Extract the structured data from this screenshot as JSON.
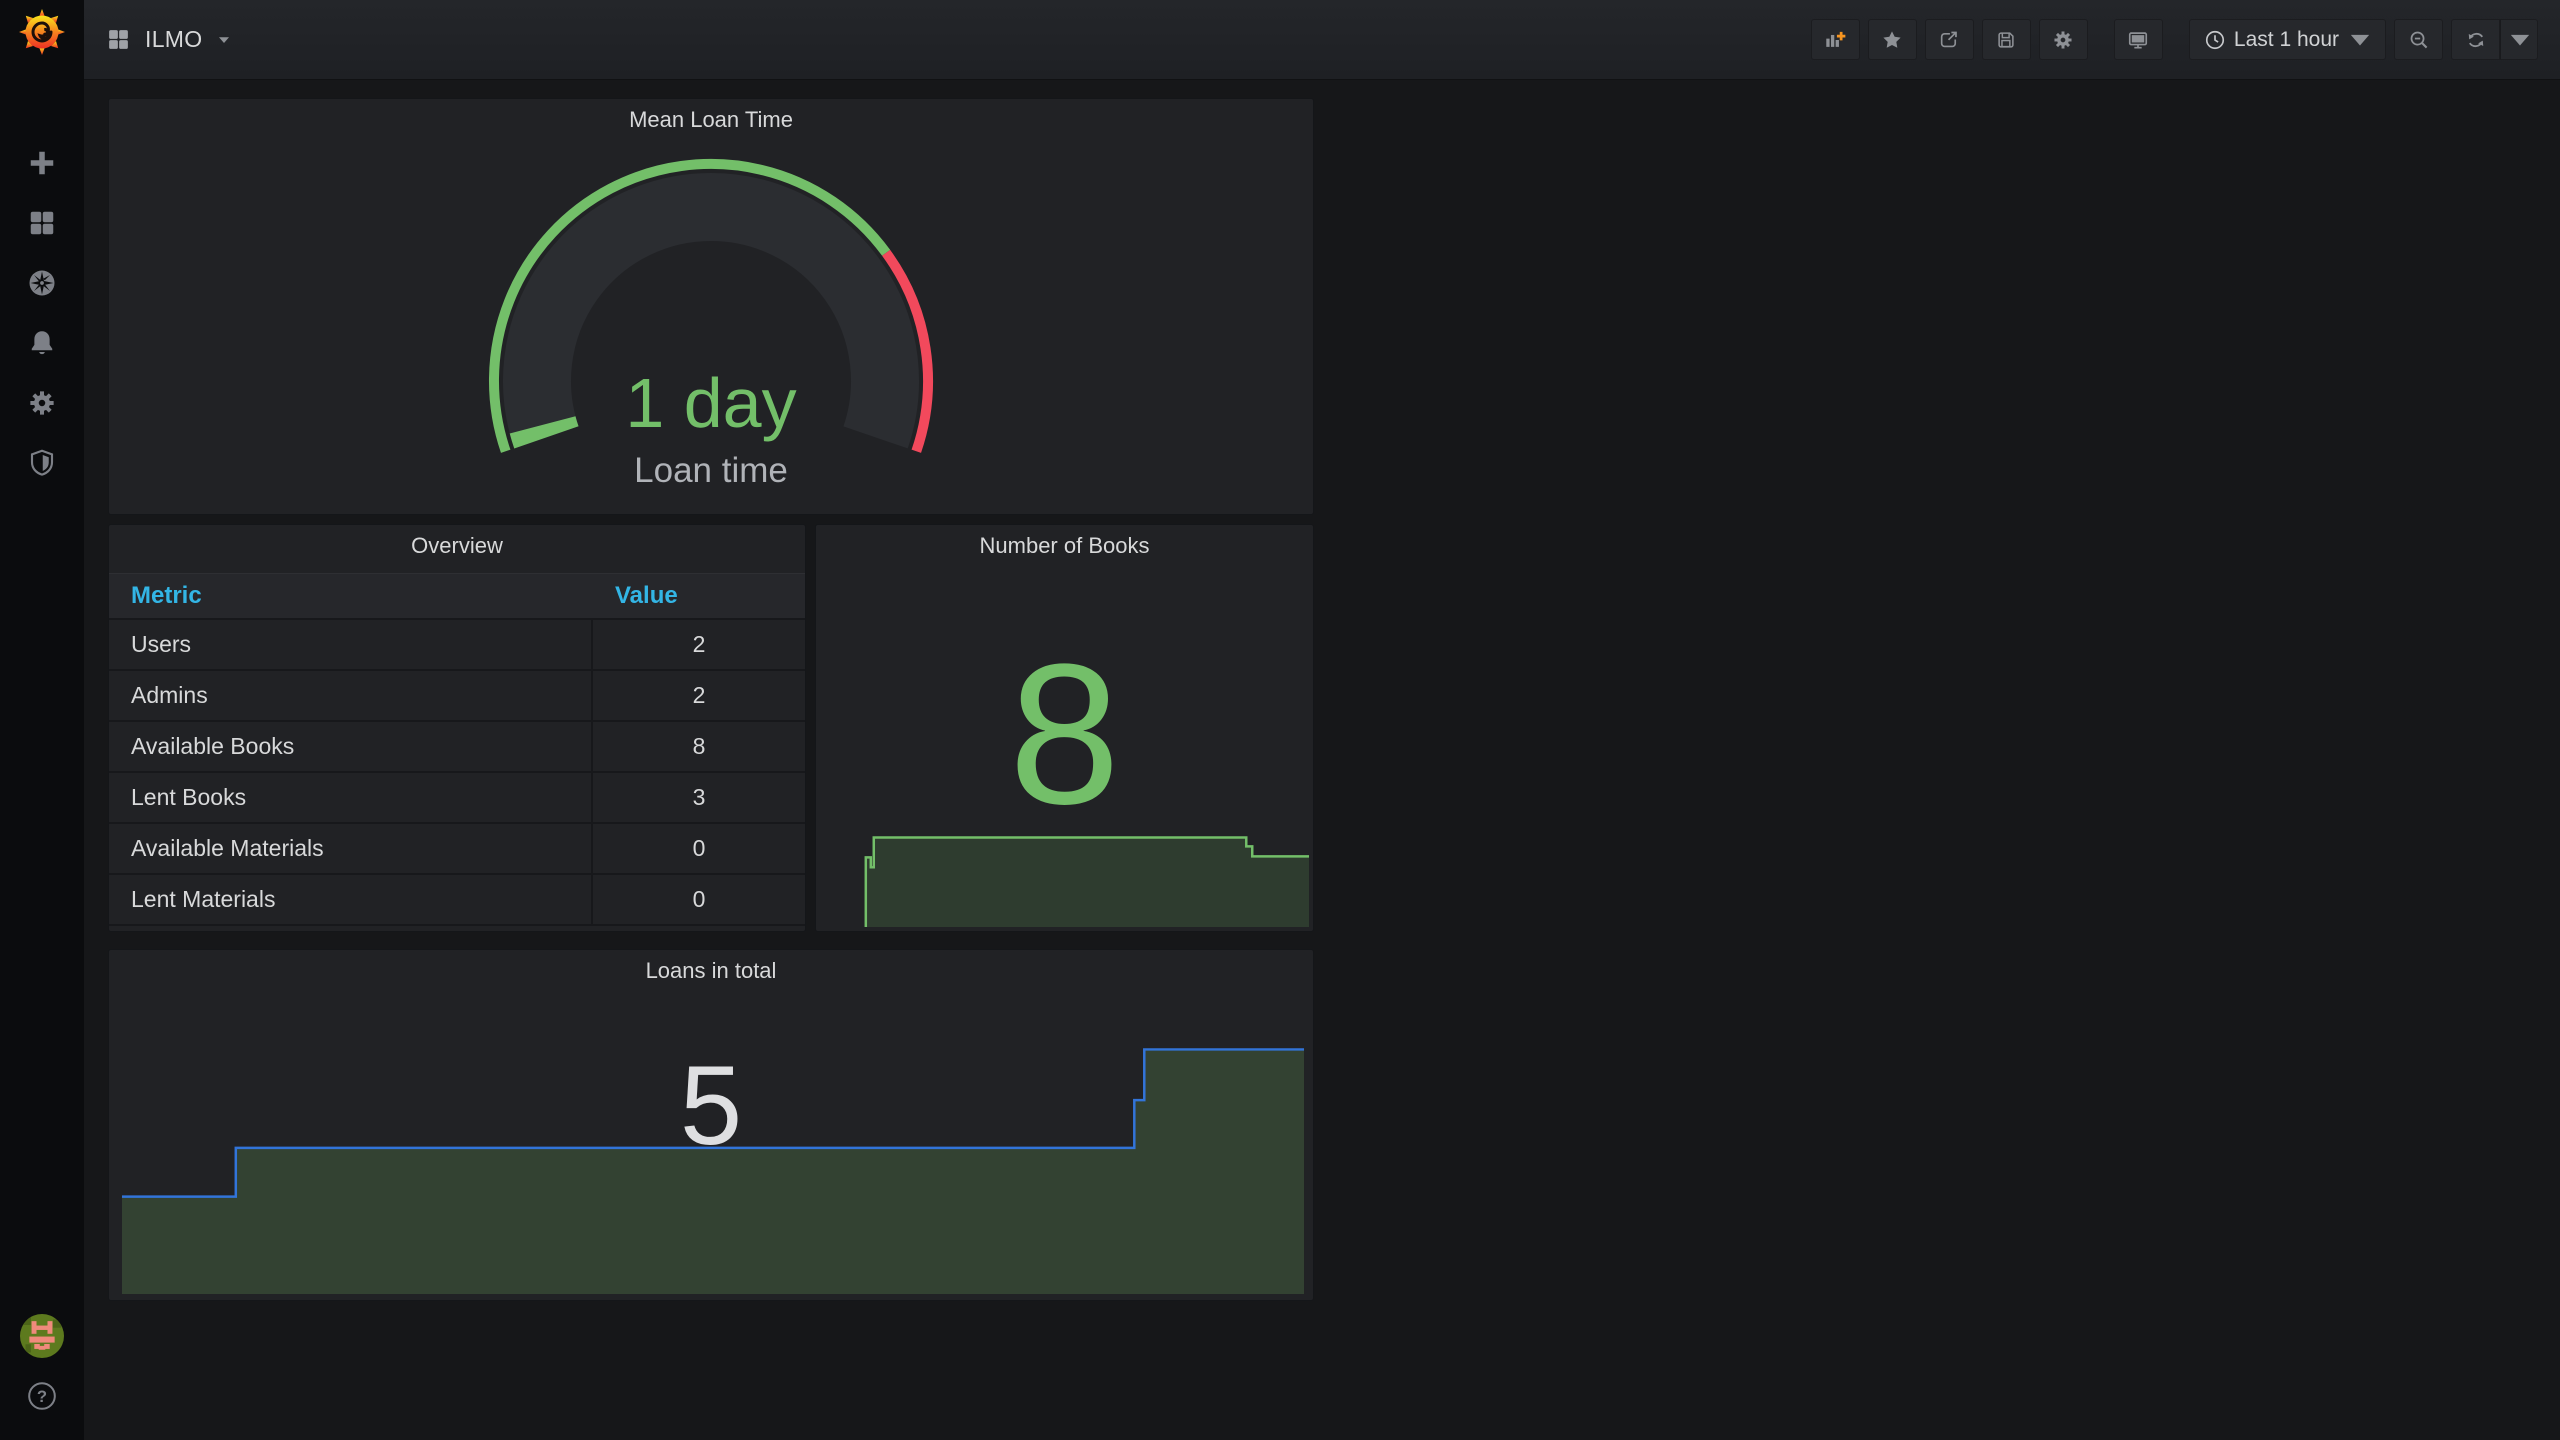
{
  "colors": {
    "green": "#73BF69",
    "red": "#F2495C",
    "table_header_blue": "#33B5E5",
    "loans_line_blue": "#3274D9",
    "books_fill": "#2e3c2f",
    "loans_fill": "#334232",
    "stat_text_gray": "#DEDFE1",
    "gauge_face": "#2b2d31"
  },
  "sidebar": {
    "logo_icon": "grafana-logo",
    "items": [
      {
        "icon": "plus-icon"
      },
      {
        "icon": "dashboards-grid-icon"
      },
      {
        "icon": "explore-compass-icon"
      },
      {
        "icon": "alerting-bell-icon"
      },
      {
        "icon": "configuration-gear-icon"
      },
      {
        "icon": "server-admin-shield-icon"
      }
    ],
    "avatar_icon": "user-avatar",
    "help_icon": "help-question-icon"
  },
  "navbar": {
    "dashboard_squares_icon": "dashboard-squares-icon",
    "title": "ILMO",
    "actions": [
      {
        "name": "add-panel",
        "icon": "add-panel-icon"
      },
      {
        "name": "mark-as-favorite",
        "icon": "star-icon"
      },
      {
        "name": "share-dashboard",
        "icon": "share-icon"
      },
      {
        "name": "save-dashboard",
        "icon": "save-icon"
      },
      {
        "name": "dashboard-settings",
        "icon": "gear-icon"
      },
      {
        "name": "cycle-view-mode",
        "icon": "monitor-icon"
      }
    ],
    "time_picker": {
      "icon": "clock-icon",
      "label": "Last 1 hour",
      "caret": "chevron-down-icon"
    },
    "zoom_out": {
      "icon": "zoom-out-icon"
    },
    "refresh": {
      "icon": "refresh-icon",
      "caret": "chevron-down-icon"
    }
  },
  "panels": {
    "mean_loan_time": {
      "title": "Mean Loan Time",
      "value": "1 day",
      "label": "Loan time",
      "value_color": "#73BF69",
      "threshold_green": "#73BF69",
      "threshold_red": "#F2495C",
      "red_start_percent": 75
    },
    "overview": {
      "title": "Overview",
      "columns": [
        "Metric",
        "Value"
      ],
      "rows": [
        [
          "Users",
          "2"
        ],
        [
          "Admins",
          "2"
        ],
        [
          "Available Books",
          "8"
        ],
        [
          "Lent Books",
          "3"
        ],
        [
          "Available Materials",
          "0"
        ],
        [
          "Lent Materials",
          "0"
        ]
      ]
    },
    "number_of_books": {
      "title": "Number of Books",
      "value": "8",
      "value_color": "#73BF69",
      "line_color": "#73BF69",
      "fill_color": "#2e3c2f",
      "line": [
        [
          50,
          404
        ],
        [
          50,
          334
        ],
        [
          55,
          334
        ],
        [
          55,
          344
        ],
        [
          58,
          344
        ],
        [
          58,
          314
        ],
        [
          432,
          314
        ],
        [
          432,
          323
        ],
        [
          438,
          323
        ],
        [
          438,
          333
        ],
        [
          495,
          333
        ]
      ],
      "fill": [
        [
          50,
          404
        ],
        [
          50,
          334
        ],
        [
          55,
          334
        ],
        [
          55,
          344
        ],
        [
          58,
          344
        ],
        [
          58,
          314
        ],
        [
          432,
          314
        ],
        [
          432,
          323
        ],
        [
          438,
          323
        ],
        [
          438,
          333
        ],
        [
          495,
          333
        ],
        [
          495,
          404
        ]
      ]
    },
    "loans_in_total": {
      "title": "Loans in total",
      "value": "5",
      "value_color": "#DEDFE1",
      "line_color": "#3274D9",
      "fill_color": "#334232",
      "line": [
        [
          13,
          248
        ],
        [
          127,
          248
        ],
        [
          127,
          199
        ],
        [
          1027,
          199
        ],
        [
          1027,
          151
        ],
        [
          1037,
          151
        ],
        [
          1037,
          100
        ],
        [
          1197,
          100
        ]
      ],
      "fill": [
        [
          13,
          346
        ],
        [
          13,
          248
        ],
        [
          127,
          248
        ],
        [
          127,
          199
        ],
        [
          1027,
          199
        ],
        [
          1027,
          151
        ],
        [
          1037,
          151
        ],
        [
          1037,
          100
        ],
        [
          1197,
          100
        ],
        [
          1197,
          346
        ]
      ]
    }
  }
}
